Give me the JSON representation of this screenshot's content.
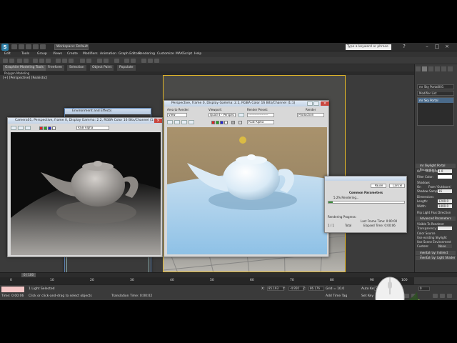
{
  "app": {
    "logo": "S",
    "workspace": "Workspace: Default",
    "search_placeholder": "Type a keyword or phrase",
    "window_buttons": [
      "–",
      "□",
      "×"
    ]
  },
  "menubar": [
    "Edit",
    "Tools",
    "Group",
    "Views",
    "Create",
    "Modifiers",
    "Animation",
    "Graph Editors",
    "Rendering",
    "Customize",
    "MAXScript",
    "Help"
  ],
  "ribbon": {
    "tabs": [
      "Graphite Modeling Tools",
      "Freeform",
      "Selection",
      "Object Paint",
      "Populate"
    ],
    "sub_label": "Polygon Modeling"
  },
  "viewport": {
    "label": "[+] [Perspective] [Realistic]"
  },
  "frame_window_left": {
    "title": "Camera01, Perspective, frame 0, Display Gamma: 2.2, RGBA Color 16 Bits/Channel (1:1)",
    "channel": "RGB Alpha",
    "close": "×"
  },
  "frame_window_right": {
    "title": "Perspective, frame 0, Display Gamma: 2.2, RGBA Color 16 Bits/Channel (1:1)",
    "area_label": "Area to Render:",
    "area_value": "View",
    "viewport_label": "Viewport:",
    "viewport_value": "Quad 4 - Perspec",
    "preset_label": "Render Preset:",
    "preset_value": "-------------------",
    "render_button": "Render",
    "production_value": "Production",
    "channel": "RGB Alpha",
    "close": "×"
  },
  "environment_window": {
    "title": "Environment and Effects"
  },
  "rendering_dialog": {
    "pause": "Pause",
    "cancel": "Cancel",
    "status": "5.2% Rendering...",
    "section": "Common Parameters",
    "progress_label": "Rendering Progress:",
    "last_frame": "Last Frame Time: 0:00:00",
    "elapsed": "Elapsed Time: 0:00:06",
    "total": "Total",
    "frame": "1 / 1"
  },
  "command_panel": {
    "object_name": "mr Sky Portal001",
    "modifier_list": "Modifier List",
    "stack_item": "mr Sky Portal",
    "params_header": "mr Skylight Portal Parameters",
    "on_label": "On",
    "multiplier_label": "Multiplier:",
    "multiplier_value": "1.0",
    "filter_color": "Filter Color:",
    "shadows_label": "Shadows",
    "on2": "On",
    "from_outdoors": "From 'Outdoors'",
    "shadow_samples": "Shadow Samples:",
    "shadow_samples_value": "16",
    "dimensions": "Dimensions",
    "length_label": "Length:",
    "length_value": "1200.0",
    "width_label": "Width:",
    "width_value": "1400.0",
    "flip_light": "Flip Light Flux Direction",
    "advanced_header": "Advanced Parameters",
    "visible_renderer": "Visible To Renderer",
    "transparency": "Transparency:",
    "color_source": "Color Source",
    "use_existing": "Use existing Skylight",
    "use_scene": "Use Scene Environment",
    "custom": "Custom:",
    "custom_value": "None",
    "indirect_header": "mental ray: Indirect Illumination",
    "light_shader_header": "mental ray: Light Shader"
  },
  "timeline": {
    "position": "0 / 100",
    "ticks": [
      "0",
      "10",
      "20",
      "30",
      "40",
      "50",
      "60",
      "70",
      "80",
      "90",
      "100"
    ]
  },
  "statusbar": {
    "selection": "1 Light Selected",
    "prompt": "Click or click-and-drag to select objects",
    "time": "Time: 0:00:06",
    "translation_time": "Translation Time: 0:00:02",
    "x_label": "X:",
    "x_value": "85.193",
    "y_label": "Y:",
    "y_value": "-4.950",
    "z_label": "Z:",
    "z_value": "86.176",
    "grid": "Grid = 10.0",
    "autokey": "Auto Key",
    "selected": "Selected",
    "setkey": "Set Key",
    "key_filters": "Key Filters...",
    "add_time_tag": "Add Time Tag",
    "frame_value": "0"
  },
  "colors": {
    "viewport_highlight": "#e2b629",
    "command_panel": "#3d3d3d",
    "dialog_blue": "#c3d3e6"
  }
}
